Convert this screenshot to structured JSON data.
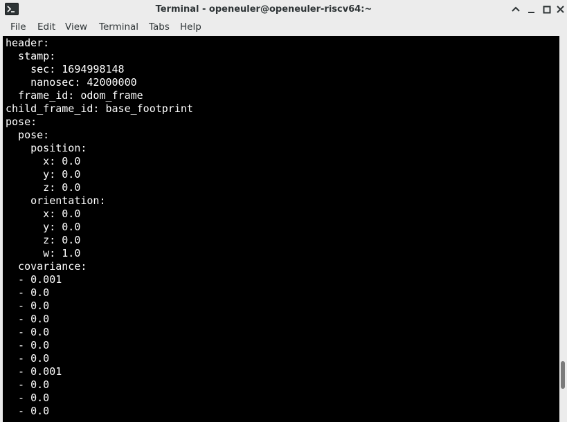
{
  "window": {
    "title": "Terminal - openeuler@openeuler-riscv64:~",
    "app_icon": "terminal-icon",
    "controls": [
      "chevron-up-icon",
      "minimize-icon",
      "maximize-icon",
      "close-icon"
    ]
  },
  "menubar": {
    "items": [
      {
        "label": "File"
      },
      {
        "label": "Edit"
      },
      {
        "label": "View"
      },
      {
        "label": "Terminal"
      },
      {
        "label": "Tabs"
      },
      {
        "label": "Help"
      }
    ]
  },
  "terminal": {
    "background": "#000000",
    "foreground": "#ffffff",
    "lines": [
      "header:",
      "  stamp:",
      "    sec: 1694998148",
      "    nanosec: 42000000",
      "  frame_id: odom_frame",
      "child_frame_id: base_footprint",
      "pose:",
      "  pose:",
      "    position:",
      "      x: 0.0",
      "      y: 0.0",
      "      z: 0.0",
      "    orientation:",
      "      x: 0.0",
      "      y: 0.0",
      "      z: 0.0",
      "      w: 1.0",
      "  covariance:",
      "  - 0.001",
      "  - 0.0",
      "  - 0.0",
      "  - 0.0",
      "  - 0.0",
      "  - 0.0",
      "  - 0.0",
      "  - 0.001",
      "  - 0.0",
      "  - 0.0",
      "  - 0.0"
    ]
  },
  "scrollbar": {
    "position": 0.86
  }
}
